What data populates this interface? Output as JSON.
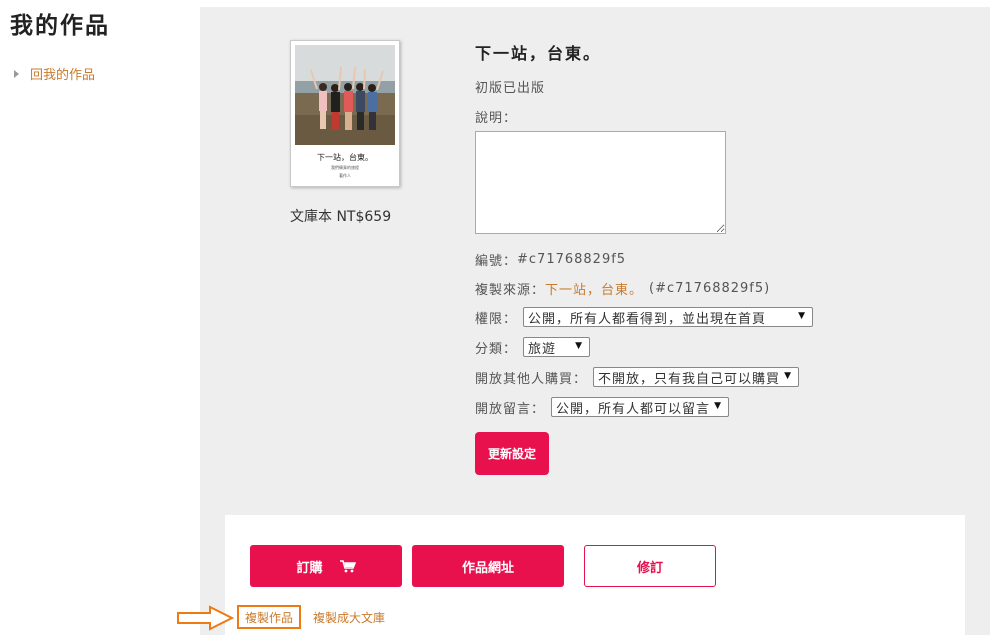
{
  "sidebar": {
    "title": "我的作品",
    "back_link": "回我的作品"
  },
  "book": {
    "cover_title": "下一站，台東。",
    "cover_subtitle": "我們騎乘的旅程",
    "cover_author": "著作人",
    "price": "文庫本 NT$659",
    "title": "下一站，台東。",
    "status": "初版已出版",
    "description_label": "說明：",
    "description_value": "",
    "id_label": "編號：",
    "id_value": "#c71768829f5",
    "source_label": "複製來源：",
    "source_link": "下一站，台東。",
    "source_id": "(#c71768829f5)"
  },
  "settings": {
    "permission_label": "權限：",
    "permission_value": "公開，所有人都看得到，並出現在首頁",
    "category_label": "分類：",
    "category_value": "旅遊",
    "purchase_label": "開放其他人購買：",
    "purchase_value": "不開放，只有我自己可以購買",
    "comment_label": "開放留言：",
    "comment_value": "公開，所有人都可以留言",
    "update_button": "更新設定"
  },
  "actions": {
    "order_button": "訂購",
    "url_button": "作品網址",
    "revise_button": "修訂",
    "copy_work": "複製作品",
    "copy_library": "複製成大文庫"
  },
  "icons": {
    "cart": "cart-icon",
    "pointer": "arrow-right-icon",
    "bullet": "triangle-right-icon"
  },
  "colors": {
    "accent": "#e8114e",
    "link": "#c97a2b",
    "highlight": "#ee7a14",
    "panel": "#eeeeee"
  }
}
